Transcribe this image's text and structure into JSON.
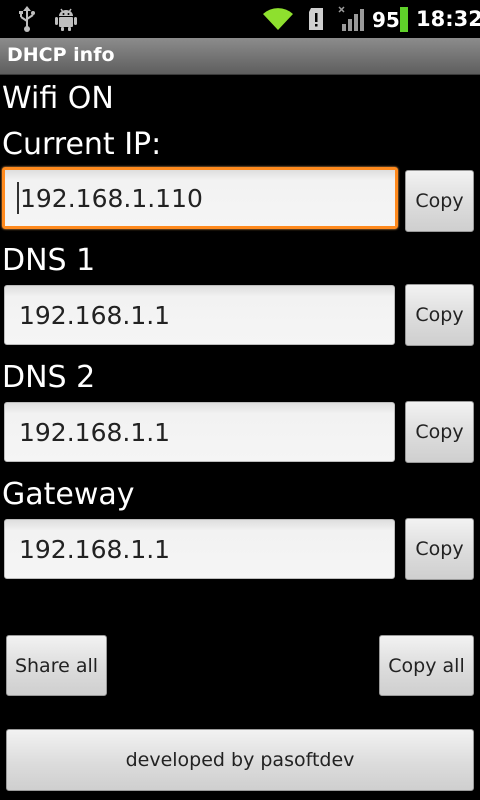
{
  "status_bar": {
    "icons_left": [
      "usb-icon",
      "android-debug-icon"
    ],
    "icons_right": [
      "wifi-icon",
      "sd-card-alert-icon",
      "signal-icon"
    ],
    "battery_level": "95",
    "time": "18:32"
  },
  "app": {
    "title": "DHCP info"
  },
  "wifi_status": "Wifi ON",
  "current_ip": {
    "label": "Current IP:",
    "value": "192.168.1.110",
    "copy_label": "Copy"
  },
  "dns1": {
    "label": "DNS 1",
    "value": "192.168.1.1",
    "copy_label": "Copy"
  },
  "dns2": {
    "label": "DNS 2",
    "value": "192.168.1.1",
    "copy_label": "Copy"
  },
  "gateway": {
    "label": "Gateway",
    "value": "192.168.1.1",
    "copy_label": "Copy"
  },
  "actions": {
    "share_all_label": "Share all",
    "copy_all_label": "Copy all",
    "developer_label": "developed by pasoftdev"
  },
  "colors": {
    "focus_accent": "#ff8a1e",
    "wifi_green": "#8ee02e",
    "battery_green": "#5fd12a"
  }
}
